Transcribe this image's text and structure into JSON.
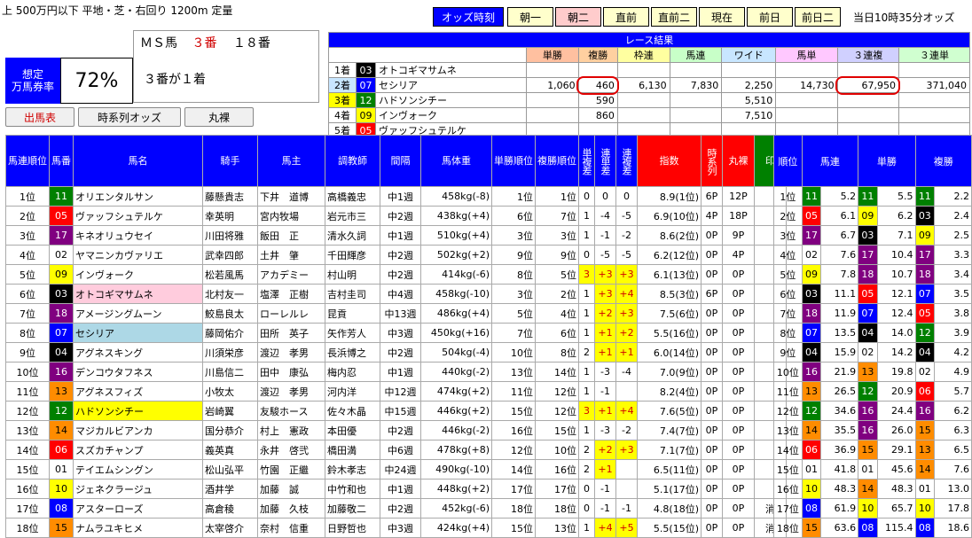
{
  "header": {
    "race_info": "上 500万円以下 平地・芝・右回り 1200m 定量",
    "odds_time_label": "オッズ時刻",
    "tabs": [
      "朝一",
      "朝二",
      "直前",
      "直前二",
      "現在",
      "前日",
      "前日二"
    ],
    "active_tab": 1,
    "clock": "当日10時35分オッズ"
  },
  "ms": {
    "prefix": "ＭＳ馬",
    "number": "３番",
    "count": "１８番",
    "sub": "３番が１着"
  },
  "rate": {
    "label1": "想定",
    "label2": "万馬券率",
    "value": "72%"
  },
  "buttons": {
    "b1": "出馬表",
    "b2": "時系列オッズ",
    "b3": "丸裸"
  },
  "result": {
    "title": "レース結果",
    "headers": [
      "単勝",
      "複勝",
      "枠連",
      "馬連",
      "ワイド",
      "馬単",
      "３連複",
      "３連単"
    ],
    "rows": [
      {
        "pos": "1着",
        "num": "03",
        "name": "オトコギマサムネ",
        "cls": "blk",
        "vals": [
          "",
          "",
          "",
          "",
          "",
          "",
          "",
          ""
        ]
      },
      {
        "pos": "2着",
        "num": "07",
        "name": "セシリア",
        "cls": "blu",
        "vals": [
          "1,060",
          "460",
          "6,130",
          "7,830",
          "2,250",
          "14,730",
          "67,950",
          "371,040"
        ]
      },
      {
        "pos": "3着",
        "num": "12",
        "name": "ハドソンシチー",
        "cls": "grn",
        "vals": [
          "",
          "590",
          "",
          "",
          "5,510",
          "",
          "",
          ""
        ]
      },
      {
        "pos": "4着",
        "num": "09",
        "name": "インヴォーク",
        "cls": "ylw",
        "vals": [
          "",
          "860",
          "",
          "",
          "7,510",
          "",
          "",
          ""
        ]
      },
      {
        "pos": "5着",
        "num": "05",
        "name": "ヴァッフシュテルケ",
        "cls": "red",
        "vals": [
          "",
          "",
          "",
          "",
          "",
          "",
          "",
          ""
        ]
      }
    ]
  },
  "main": {
    "headers": [
      "馬連順位",
      "馬番",
      "馬名",
      "騎手",
      "馬主",
      "調教師",
      "間隔",
      "馬体重",
      "単勝順位",
      "複勝順位",
      "単複差",
      "連単差",
      "連複差",
      "指数",
      "時系列",
      "丸裸",
      "印"
    ],
    "rows": [
      [
        "1位",
        "11",
        "オリエンタルサン",
        "藤懸貴志",
        "下井　道博",
        "高橋義忠",
        "中1週",
        "458kg(-8)",
        "1位",
        "1位",
        "0",
        "0",
        "0",
        "8.9(1位)",
        "6P",
        "12P",
        ""
      ],
      [
        "2位",
        "05",
        "ヴァッフシュテルケ",
        "幸英明",
        "宮内牧場",
        "岩元市三",
        "中2週",
        "438kg(+4)",
        "6位",
        "7位",
        "1",
        "-4",
        "-5",
        "6.9(10位)",
        "4P",
        "18P",
        ""
      ],
      [
        "3位",
        "17",
        "キネオリュウセイ",
        "川田将雅",
        "飯田　正",
        "清水久詞",
        "中1週",
        "510kg(+4)",
        "3位",
        "3位",
        "1",
        "-1",
        "-2",
        "8.6(2位)",
        "0P",
        "9P",
        ""
      ],
      [
        "4位",
        "02",
        "ヤマニンカヴァリエ",
        "武幸四郎",
        "土井　肇",
        "千田輝彦",
        "中2週",
        "502kg(+2)",
        "9位",
        "9位",
        "0",
        "-5",
        "-5",
        "6.2(12位)",
        "0P",
        "4P",
        ""
      ],
      [
        "5位",
        "09",
        "インヴォーク",
        "松若風馬",
        "アカデミー",
        "村山明",
        "中2週",
        "414kg(-6)",
        "8位",
        "5位",
        "3",
        "+3",
        "+3",
        "6.1(13位)",
        "0P",
        "0P",
        ""
      ],
      [
        "6位",
        "03",
        "オトコギマサムネ",
        "北村友一",
        "塩澤　正樹",
        "吉村圭司",
        "中4週",
        "458kg(-10)",
        "3位",
        "2位",
        "1",
        "+3",
        "+4",
        "8.5(3位)",
        "6P",
        "0P",
        ""
      ],
      [
        "7位",
        "18",
        "アメージングムーン",
        "鮫島良太",
        "ローレルレ",
        "昆貢",
        "中13週",
        "486kg(+4)",
        "5位",
        "4位",
        "1",
        "+2",
        "+3",
        "7.5(6位)",
        "0P",
        "0P",
        ""
      ],
      [
        "8位",
        "07",
        "セシリア",
        "藤岡佑介",
        "田所　英子",
        "矢作芳人",
        "中3週",
        "450kg(+16)",
        "7位",
        "6位",
        "1",
        "+1",
        "+2",
        "5.5(16位)",
        "0P",
        "0P",
        ""
      ],
      [
        "9位",
        "04",
        "アグネスキング",
        "川須栄彦",
        "渡辺　孝男",
        "長浜博之",
        "中2週",
        "504kg(-4)",
        "10位",
        "8位",
        "2",
        "+1",
        "+1",
        "6.0(14位)",
        "0P",
        "0P",
        ""
      ],
      [
        "10位",
        "16",
        "デンコウタフネス",
        "川島信二",
        "田中　康弘",
        "梅内忍",
        "中1週",
        "440kg(-2)",
        "13位",
        "14位",
        "1",
        "-3",
        "-4",
        "7.0(9位)",
        "0P",
        "0P",
        ""
      ],
      [
        "11位",
        "13",
        "アグネスフィズ",
        "小牧太",
        "渡辺　孝男",
        "河内洋",
        "中12週",
        "474kg(+2)",
        "11位",
        "12位",
        "1",
        "-1",
        "",
        "8.2(4位)",
        "0P",
        "0P",
        ""
      ],
      [
        "12位",
        "12",
        "ハドソンシチー",
        "岩崎翼",
        "友駿ホース",
        "佐々木晶",
        "中15週",
        "446kg(+2)",
        "15位",
        "12位",
        "3",
        "+1",
        "+4",
        "7.6(5位)",
        "0P",
        "0P",
        ""
      ],
      [
        "13位",
        "14",
        "マジカルビアンカ",
        "国分恭介",
        "村上　憲政",
        "本田優",
        "中2週",
        "446kg(-2)",
        "16位",
        "15位",
        "1",
        "-3",
        "-2",
        "7.4(7位)",
        "0P",
        "0P",
        ""
      ],
      [
        "14位",
        "06",
        "スズカチャンプ",
        "義英真",
        "永井　啓弐",
        "橋田満",
        "中6週",
        "478kg(+8)",
        "12位",
        "10位",
        "2",
        "+2",
        "+3",
        "7.1(7位)",
        "0P",
        "0P",
        ""
      ],
      [
        "15位",
        "01",
        "テイエムシングン",
        "松山弘平",
        "竹園　正繼",
        "鈴木孝志",
        "中24週",
        "490kg(-10)",
        "14位",
        "16位",
        "2",
        "+1",
        "",
        "6.5(11位)",
        "0P",
        "0P",
        ""
      ],
      [
        "16位",
        "10",
        "ジェネクラージュ",
        "酒井学",
        "加藤　誠",
        "中竹和也",
        "中1週",
        "448kg(+2)",
        "17位",
        "17位",
        "0",
        "-1",
        "",
        "5.1(17位)",
        "0P",
        "0P",
        ""
      ],
      [
        "17位",
        "08",
        "アスターローズ",
        "高倉稜",
        "加藤　久枝",
        "加藤敬二",
        "中2週",
        "452kg(-6)",
        "18位",
        "18位",
        "0",
        "-1",
        "-1",
        "4.8(18位)",
        "0P",
        "0P",
        "消"
      ],
      [
        "18位",
        "15",
        "ナムラユキヒメ",
        "太宰啓介",
        "奈村　信重",
        "日野哲也",
        "中3週",
        "424kg(+4)",
        "15位",
        "13位",
        "1",
        "+4",
        "+5",
        "5.5(15位)",
        "0P",
        "0P",
        "消"
      ]
    ]
  },
  "side": {
    "headers": [
      "順位",
      "馬連",
      "単勝",
      "複勝"
    ],
    "rows": [
      [
        "1位",
        "11",
        "5.2",
        "11",
        "5.5",
        "11",
        "2.2"
      ],
      [
        "2位",
        "05",
        "6.1",
        "09",
        "6.2",
        "03",
        "2.4"
      ],
      [
        "3位",
        "17",
        "6.7",
        "03",
        "7.1",
        "09",
        "2.5"
      ],
      [
        "4位",
        "02",
        "7.6",
        "17",
        "10.4",
        "17",
        "3.3"
      ],
      [
        "5位",
        "09",
        "7.8",
        "18",
        "10.7",
        "18",
        "3.4"
      ],
      [
        "6位",
        "03",
        "11.1",
        "05",
        "12.1",
        "07",
        "3.5"
      ],
      [
        "7位",
        "18",
        "11.9",
        "07",
        "12.4",
        "05",
        "3.8"
      ],
      [
        "8位",
        "07",
        "13.5",
        "04",
        "14.0",
        "12",
        "3.9"
      ],
      [
        "9位",
        "04",
        "15.9",
        "02",
        "14.2",
        "04",
        "4.2"
      ],
      [
        "10位",
        "16",
        "21.9",
        "13",
        "19.8",
        "02",
        "4.9"
      ],
      [
        "11位",
        "13",
        "26.5",
        "12",
        "20.9",
        "06",
        "5.7"
      ],
      [
        "12位",
        "12",
        "34.6",
        "16",
        "24.4",
        "16",
        "6.2"
      ],
      [
        "13位",
        "14",
        "35.5",
        "16",
        "26.0",
        "15",
        "6.3"
      ],
      [
        "14位",
        "06",
        "36.9",
        "15",
        "29.1",
        "13",
        "6.5"
      ],
      [
        "15位",
        "01",
        "41.8",
        "01",
        "45.6",
        "14",
        "7.6"
      ],
      [
        "16位",
        "10",
        "48.3",
        "14",
        "48.3",
        "01",
        "13.0"
      ],
      [
        "17位",
        "08",
        "61.9",
        "10",
        "65.7",
        "10",
        "17.8"
      ],
      [
        "18位",
        "15",
        "63.6",
        "08",
        "115.4",
        "08",
        "18.6"
      ]
    ]
  }
}
